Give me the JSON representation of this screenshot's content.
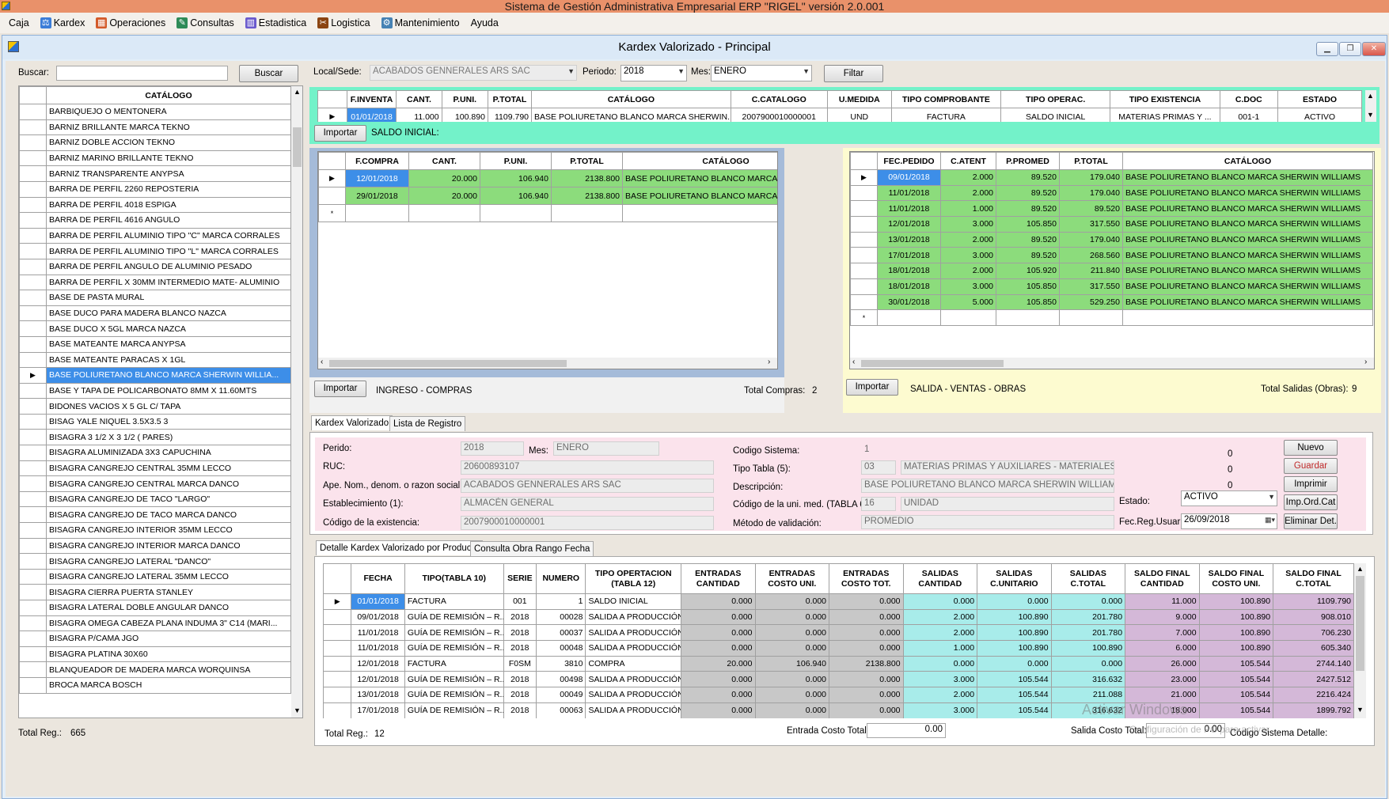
{
  "app": {
    "title": "Sistema de Gestión Administrativa Empresarial ERP  \"RIGEL\" versión 2.0.001",
    "menu": [
      {
        "label": "Caja",
        "icon": ""
      },
      {
        "label": "Kardex",
        "icon": "kardex-icon"
      },
      {
        "label": "Operaciones",
        "icon": "operaciones-icon"
      },
      {
        "label": "Consultas",
        "icon": "consultas-icon"
      },
      {
        "label": "Estadistica",
        "icon": "chart-icon"
      },
      {
        "label": "Logistica",
        "icon": "tools-icon"
      },
      {
        "label": "Mantenimiento",
        "icon": "maintenance-icon"
      },
      {
        "label": "Ayuda",
        "icon": ""
      }
    ]
  },
  "window": {
    "title": "Kardex Valorizado - Principal"
  },
  "search": {
    "label": "Buscar:",
    "value": "",
    "button": "Buscar"
  },
  "catalog": {
    "header": "CATÁLOGO",
    "selected_index": 17,
    "total_label": "Total Reg.:",
    "total": "665",
    "items": [
      "BARBIQUEJO O MENTONERA",
      "BARNIZ BRILLANTE MARCA TEKNO",
      "BARNIZ DOBLE ACCION TEKNO",
      "BARNIZ MARINO BRILLANTE TEKNO",
      "BARNIZ TRANSPARENTE ANYPSA",
      "BARRA DE PERFIL 2260 REPOSTERIA",
      "BARRA DE PERFIL 4018 ESPIGA",
      "BARRA DE PERFIL 4616 ANGULO",
      "BARRA DE PERFIL ALUMINIO TIPO \"C\" MARCA CORRALES",
      "BARRA DE PERFIL ALUMINIO TIPO \"L\" MARCA CORRALES",
      "BARRA DE PERFIL ANGULO DE ALUMINIO PESADO",
      "BARRA DE PERFIL X 30MM INTERMEDIO MATE- ALUMINIO",
      "BASE DE PASTA MURAL",
      "BASE DUCO PARA MADERA BLANCO NAZCA",
      "BASE DUCO X 5GL MARCA NAZCA",
      "BASE MATEANTE MARCA ANYPSA",
      "BASE MATEANTE PARACAS X 1GL",
      "BASE POLIURETANO BLANCO MARCA SHERWIN WILLIA...",
      "BASE Y TAPA DE POLICARBONATO 8MM X 11.60MTS",
      "BIDONES VACIOS X 5 GL C/ TAPA",
      "BISAG YALE NIQUEL 3.5X3.5 3",
      "BISAGRA 3 1/2 X 3 1/2 ( PARES)",
      "BISAGRA ALUMINIZADA 3X3 CAPUCHINA",
      "BISAGRA CANGREJO CENTRAL 35MM LECCO",
      "BISAGRA CANGREJO CENTRAL MARCA DANCO",
      "BISAGRA CANGREJO DE TACO \"LARGO\"",
      "BISAGRA CANGREJO DE TACO MARCA DANCO",
      "BISAGRA CANGREJO INTERIOR 35MM LECCO",
      "BISAGRA CANGREJO INTERIOR MARCA DANCO",
      "BISAGRA CANGREJO LATERAL \"DANCO\"",
      "BISAGRA CANGREJO LATERAL 35MM LECCO",
      "BISAGRA CIERRA PUERTA STANLEY",
      "BISAGRA LATERAL DOBLE ANGULAR DANCO",
      "BISAGRA OMEGA CABEZA PLANA INDUMA 3\" C14 (MARI...",
      "BISAGRA P/CAMA JGO",
      "BISAGRA PLATINA 30X60",
      "BLANQUEADOR DE MADERA MARCA WORQUINSA",
      "BROCA  MARCA BOSCH"
    ]
  },
  "filter": {
    "local_label": "Local/Sede:",
    "local_value": "ACABADOS GENNERALES ARS SAC",
    "periodo_label": "Periodo:",
    "periodo_value": "2018",
    "mes_label": "Mes:",
    "mes_value": "ENERO",
    "button": "Filtar"
  },
  "saldo": {
    "columns": [
      "F.INVENTA",
      "CANT.",
      "P.UNI.",
      "P.TOTAL",
      "CATÁLOGO",
      "C.CATALOGO",
      "U.MEDIDA",
      "TIPO COMPROBANTE",
      "TIPO OPERAC.",
      "TIPO EXISTENCIA",
      "C.DOC",
      "ESTADO"
    ],
    "row": [
      "01/01/2018",
      "11.000",
      "100.890",
      "1109.790",
      "BASE POLIURETANO BLANCO MARCA SHERWIN...",
      "2007900010000001",
      "UND",
      "FACTURA",
      "SALDO INICIAL",
      "MATERIAS PRIMAS Y ...",
      "001-1",
      "ACTIVO"
    ],
    "import_button": "Importar",
    "label": "SALDO INICIAL:"
  },
  "compras": {
    "columns": [
      "F.COMPRA",
      "CANT.",
      "P.UNI.",
      "P.TOTAL",
      "CATÁLOGO"
    ],
    "rows": [
      [
        "12/01/2018",
        "20.000",
        "106.940",
        "2138.800",
        "BASE POLIURETANO BLANCO MARCA SHERWIN WILLIAMS"
      ],
      [
        "29/01/2018",
        "20.000",
        "106.940",
        "2138.800",
        "BASE POLIURETANO BLANCO MARCA SHERWIN WILLIAMS"
      ]
    ],
    "import_button": "Importar",
    "label": "INGRESO - COMPRAS",
    "total_label": "Total Compras:",
    "total": "2"
  },
  "salidas": {
    "columns": [
      "FEC.PEDIDO",
      "C.ATENT",
      "P.PROMED",
      "P.TOTAL",
      "CATÁLOGO"
    ],
    "rows": [
      [
        "09/01/2018",
        "2.000",
        "89.520",
        "179.040",
        "BASE POLIURETANO BLANCO MARCA SHERWIN WILLIAMS"
      ],
      [
        "11/01/2018",
        "2.000",
        "89.520",
        "179.040",
        "BASE POLIURETANO BLANCO MARCA SHERWIN WILLIAMS"
      ],
      [
        "11/01/2018",
        "1.000",
        "89.520",
        "89.520",
        "BASE POLIURETANO BLANCO MARCA SHERWIN WILLIAMS"
      ],
      [
        "12/01/2018",
        "3.000",
        "105.850",
        "317.550",
        "BASE POLIURETANO BLANCO MARCA SHERWIN WILLIAMS"
      ],
      [
        "13/01/2018",
        "2.000",
        "89.520",
        "179.040",
        "BASE POLIURETANO BLANCO MARCA SHERWIN WILLIAMS"
      ],
      [
        "17/01/2018",
        "3.000",
        "89.520",
        "268.560",
        "BASE POLIURETANO BLANCO MARCA SHERWIN WILLIAMS"
      ],
      [
        "18/01/2018",
        "2.000",
        "105.920",
        "211.840",
        "BASE POLIURETANO BLANCO MARCA SHERWIN WILLIAMS"
      ],
      [
        "18/01/2018",
        "3.000",
        "105.850",
        "317.550",
        "BASE POLIURETANO BLANCO MARCA SHERWIN WILLIAMS"
      ],
      [
        "30/01/2018",
        "5.000",
        "105.850",
        "529.250",
        "BASE POLIURETANO BLANCO MARCA SHERWIN WILLIAMS"
      ]
    ],
    "import_button": "Importar",
    "label": "SALIDA - VENTAS - OBRAS",
    "total_label": "Total Salidas (Obras):",
    "total": "9"
  },
  "form": {
    "tabs": [
      "Kardex Valorizado",
      "Lista de Registro"
    ],
    "periodo_label": "Perido:",
    "periodo": "2018",
    "mes_label": "Mes:",
    "mes": "ENERO",
    "ruc_label": "RUC:",
    "ruc": "20600893107",
    "razon_label": "Ape. Nom., denom. o razon social:",
    "razon": "ACABADOS GENNERALES ARS SAC",
    "estab_label": "Establecimiento (1):",
    "estab": "ALMACÉN GENERAL",
    "codexist_label": "Código de la existencia:",
    "codexist": "2007900010000001",
    "codsis_label": "Codigo Sistema:",
    "codsis": "1",
    "tipotabla_label": "Tipo Tabla (5):",
    "tipotabla_code": "03",
    "tipotabla": "MATERIAS PRIMAS Y AUXILIARES - MATERIALES",
    "desc_label": "Descripción:",
    "desc": "BASE POLIURETANO BLANCO MARCA SHERWIN WILLIAMS",
    "unimed_label": "Código de la uni. med. (TABLA 6):",
    "unimed_code": "16",
    "unimed": "UNIDAD",
    "metodo_label": "Método de validación:",
    "metodo": "PROMEDIO",
    "zero1": "0",
    "zero2": "0",
    "zero3": "0",
    "estado_label": "Estado:",
    "estado": "ACTIVO",
    "fecreg_label": "Fec.Reg.Usuario:",
    "fecreg": "26/09/2018",
    "buttons": {
      "nuevo": "Nuevo",
      "guardar": "Guardar",
      "imprimir": "Imprimir",
      "imp_ord": "Imp.Ord.Cat",
      "eliminar": "Eliminar Det."
    }
  },
  "detail": {
    "tabs": [
      "Detalle Kardex Valorizado por Producto",
      "Consulta Obra Rango Fecha"
    ],
    "columns": [
      "FECHA",
      "TIPO(TABLA 10)",
      "SERIE",
      "NUMERO",
      "TIPO OPERTACION (TABLA 12)",
      "ENTRADAS CANTIDAD",
      "ENTRADAS COSTO UNI.",
      "ENTRADAS COSTO TOT.",
      "SALIDAS CANTIDAD",
      "SALIDAS C.UNITARIO",
      "SALIDAS C.TOTAL",
      "SALDO FINAL CANTIDAD",
      "SALDO FINAL COSTO UNI.",
      "SALDO FINAL C.TOTAL"
    ],
    "rows": [
      [
        "01/01/2018",
        "FACTURA",
        "001",
        "1",
        "SALDO INICIAL",
        "0.000",
        "0.000",
        "0.000",
        "0.000",
        "0.000",
        "0.000",
        "11.000",
        "100.890",
        "1109.790"
      ],
      [
        "09/01/2018",
        "GUÍA DE REMISIÓN – R...",
        "2018",
        "00028",
        "SALIDA A PRODUCCIÓN",
        "0.000",
        "0.000",
        "0.000",
        "2.000",
        "100.890",
        "201.780",
        "9.000",
        "100.890",
        "908.010"
      ],
      [
        "11/01/2018",
        "GUÍA DE REMISIÓN – R...",
        "2018",
        "00037",
        "SALIDA A PRODUCCIÓN",
        "0.000",
        "0.000",
        "0.000",
        "2.000",
        "100.890",
        "201.780",
        "7.000",
        "100.890",
        "706.230"
      ],
      [
        "11/01/2018",
        "GUÍA DE REMISIÓN – R...",
        "2018",
        "00048",
        "SALIDA A PRODUCCIÓN",
        "0.000",
        "0.000",
        "0.000",
        "1.000",
        "100.890",
        "100.890",
        "6.000",
        "100.890",
        "605.340"
      ],
      [
        "12/01/2018",
        "FACTURA",
        "F0SM",
        "3810",
        "COMPRA",
        "20.000",
        "106.940",
        "2138.800",
        "0.000",
        "0.000",
        "0.000",
        "26.000",
        "105.544",
        "2744.140"
      ],
      [
        "12/01/2018",
        "GUÍA DE REMISIÓN – R...",
        "2018",
        "00498",
        "SALIDA A PRODUCCIÓN",
        "0.000",
        "0.000",
        "0.000",
        "3.000",
        "105.544",
        "316.632",
        "23.000",
        "105.544",
        "2427.512"
      ],
      [
        "13/01/2018",
        "GUÍA DE REMISIÓN – R...",
        "2018",
        "00049",
        "SALIDA A PRODUCCIÓN",
        "0.000",
        "0.000",
        "0.000",
        "2.000",
        "105.544",
        "211.088",
        "21.000",
        "105.544",
        "2216.424"
      ],
      [
        "17/01/2018",
        "GUÍA DE REMISIÓN – R...",
        "2018",
        "00063",
        "SALIDA A PRODUCCIÓN",
        "0.000",
        "0.000",
        "0.000",
        "3.000",
        "105.544",
        "316.632",
        "18.000",
        "105.544",
        "1899.792"
      ]
    ],
    "total_label": "Total Reg.:",
    "total": "12",
    "entrada_label": "Entrada Costo Total:",
    "entrada": "0.00",
    "salida_label": "Salida Costo Total:",
    "salida": "0.00",
    "codsis_label": "Código Sistema Detalle:"
  },
  "watermark": {
    "line1": "Activar Windows",
    "line2": "Configuración de PC para activar"
  }
}
